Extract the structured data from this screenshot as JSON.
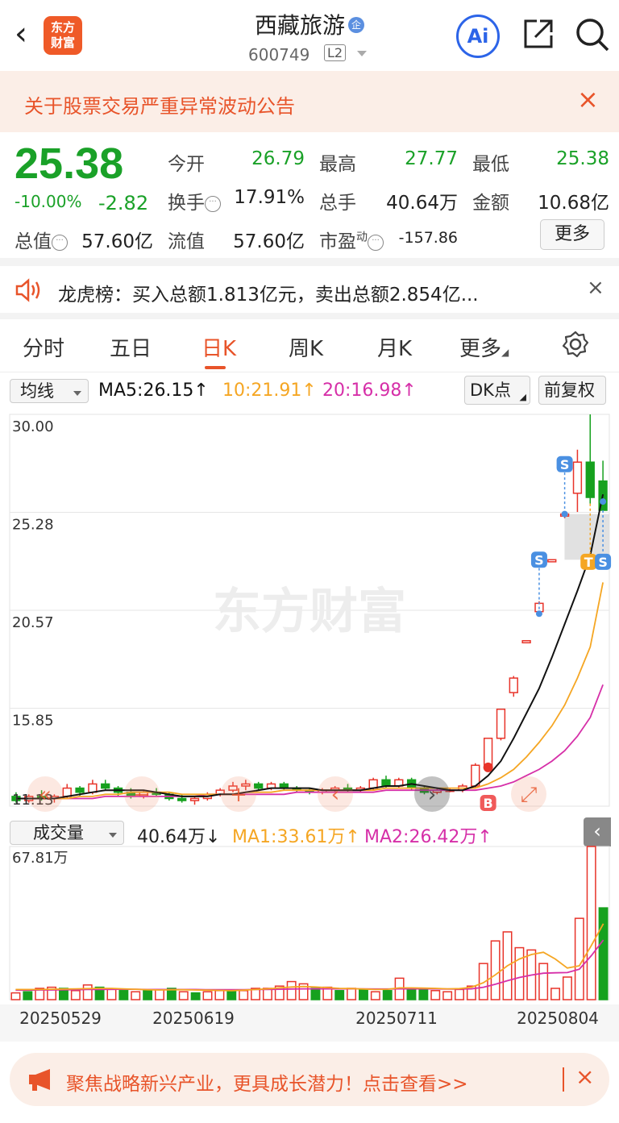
{
  "header": {
    "back_icon": "back-arrow-icon",
    "logo_text_1": "东方",
    "logo_text_2": "财富",
    "title": "西藏旅游",
    "enterprise_badge": "企",
    "code": "600749",
    "level": "L2",
    "ai_label": "Ai",
    "share_icon": "share-icon",
    "search_icon": "search-icon"
  },
  "notice": {
    "text": "关于股票交易严重异常波动公告",
    "close": "×"
  },
  "quote": {
    "price": "25.38",
    "change_pct": "-10.00%",
    "change_amt": "-2.82",
    "open_label": "今开",
    "open": "26.79",
    "high_label": "最高",
    "high": "27.77",
    "low_label": "最低",
    "low": "25.38",
    "turnover_label": "换手",
    "turnover": "17.91%",
    "volume_label": "总手",
    "volume": "40.64万",
    "amount_label": "金额",
    "amount": "10.68亿",
    "mktcap_label": "总值",
    "mktcap": "57.60亿",
    "float_label": "流值",
    "float_cap": "57.60亿",
    "pe_label": "市盈",
    "pe_sup": "动",
    "pe": "-157.86",
    "more_label": "更多"
  },
  "lhb": {
    "text": "龙虎榜：买入总额1.813亿元，卖出总额2.854亿...",
    "close": "×"
  },
  "tabs": [
    "分时",
    "五日",
    "日K",
    "周K",
    "月K",
    "更多"
  ],
  "active_tab": "日K",
  "ma_bar": {
    "selector": "均线",
    "ma5": "MA5:26.15↑",
    "ma10": "10:21.91↑",
    "ma20": "20:16.98↑",
    "dk_label": "DK点",
    "fuquan_label": "前复权"
  },
  "vol_bar": {
    "selector": "成交量",
    "vol": "40.64万↓",
    "ma1": "MA1:33.61万↑",
    "ma2": "MA2:26.42万↑"
  },
  "colors": {
    "up": "#e8342a",
    "down": "#16a11e",
    "ma5": "#111111",
    "ma10": "#f5a623",
    "ma20": "#d62fa8",
    "accent": "#e8542a"
  },
  "bottom_ad": {
    "text": "聚焦战略新兴产业，更具成长潜力！点击查看>>",
    "close": "×"
  },
  "chart_data": [
    {
      "type": "candlestick",
      "watermark": "东方财富",
      "y_ticks": [
        "30.00",
        "25.28",
        "20.57",
        "15.85",
        "11.13"
      ],
      "ylim": [
        11.13,
        30.0
      ],
      "x_ticks": [
        "20250529",
        "20250619",
        "20250711",
        "20250804"
      ],
      "candles": [
        {
          "o": 11.6,
          "h": 11.8,
          "l": 11.3,
          "c": 11.4
        },
        {
          "o": 11.4,
          "h": 11.7,
          "l": 11.3,
          "c": 11.6
        },
        {
          "o": 11.6,
          "h": 11.9,
          "l": 11.4,
          "c": 11.5
        },
        {
          "o": 11.5,
          "h": 11.7,
          "l": 11.3,
          "c": 11.6
        },
        {
          "o": 11.6,
          "h": 12.2,
          "l": 11.5,
          "c": 12.0
        },
        {
          "o": 12.0,
          "h": 12.1,
          "l": 11.6,
          "c": 11.8
        },
        {
          "o": 11.8,
          "h": 12.4,
          "l": 11.7,
          "c": 12.2
        },
        {
          "o": 12.2,
          "h": 12.4,
          "l": 11.9,
          "c": 12.0
        },
        {
          "o": 12.0,
          "h": 12.1,
          "l": 11.6,
          "c": 11.8
        },
        {
          "o": 11.8,
          "h": 12.0,
          "l": 11.5,
          "c": 11.6
        },
        {
          "o": 11.6,
          "h": 11.9,
          "l": 11.5,
          "c": 11.8
        },
        {
          "o": 11.8,
          "h": 12.0,
          "l": 11.6,
          "c": 11.7
        },
        {
          "o": 11.7,
          "h": 11.8,
          "l": 11.4,
          "c": 11.5
        },
        {
          "o": 11.5,
          "h": 11.7,
          "l": 11.3,
          "c": 11.4
        },
        {
          "o": 11.4,
          "h": 11.6,
          "l": 11.2,
          "c": 11.5
        },
        {
          "o": 11.5,
          "h": 11.8,
          "l": 11.4,
          "c": 11.7
        },
        {
          "o": 11.7,
          "h": 12.0,
          "l": 11.6,
          "c": 11.9
        },
        {
          "o": 11.9,
          "h": 12.3,
          "l": 11.8,
          "c": 12.1
        },
        {
          "o": 12.1,
          "h": 12.4,
          "l": 11.9,
          "c": 12.2
        },
        {
          "o": 12.2,
          "h": 12.3,
          "l": 11.9,
          "c": 12.0
        },
        {
          "o": 12.0,
          "h": 12.3,
          "l": 11.9,
          "c": 12.2
        },
        {
          "o": 12.2,
          "h": 12.3,
          "l": 11.9,
          "c": 12.0
        },
        {
          "o": 12.0,
          "h": 12.1,
          "l": 11.8,
          "c": 11.9
        },
        {
          "o": 11.9,
          "h": 12.0,
          "l": 11.7,
          "c": 11.8
        },
        {
          "o": 11.8,
          "h": 12.0,
          "l": 11.7,
          "c": 11.9
        },
        {
          "o": 11.9,
          "h": 12.1,
          "l": 11.8,
          "c": 12.0
        },
        {
          "o": 12.0,
          "h": 12.2,
          "l": 11.8,
          "c": 11.9
        },
        {
          "o": 11.9,
          "h": 12.1,
          "l": 11.8,
          "c": 12.0
        },
        {
          "o": 12.0,
          "h": 12.5,
          "l": 11.9,
          "c": 12.4
        },
        {
          "o": 12.4,
          "h": 12.6,
          "l": 12.0,
          "c": 12.1
        },
        {
          "o": 12.1,
          "h": 12.5,
          "l": 12.0,
          "c": 12.4
        },
        {
          "o": 12.4,
          "h": 12.5,
          "l": 11.9,
          "c": 12.0
        },
        {
          "o": 12.0,
          "h": 12.1,
          "l": 11.7,
          "c": 11.8
        },
        {
          "o": 11.8,
          "h": 12.0,
          "l": 11.7,
          "c": 11.9
        },
        {
          "o": 11.9,
          "h": 12.0,
          "l": 11.8,
          "c": 11.9
        },
        {
          "o": 11.9,
          "h": 12.2,
          "l": 11.8,
          "c": 12.1
        },
        {
          "o": 12.1,
          "h": 13.2,
          "l": 12.0,
          "c": 13.1
        },
        {
          "o": 13.1,
          "h": 14.4,
          "l": 13.0,
          "c": 14.4
        },
        {
          "o": 14.4,
          "h": 15.8,
          "l": 14.3,
          "c": 15.8
        },
        {
          "o": 16.6,
          "h": 17.4,
          "l": 16.4,
          "c": 17.3
        },
        {
          "o": 19.0,
          "h": 19.1,
          "l": 19.0,
          "c": 19.1
        },
        {
          "o": 20.5,
          "h": 21.0,
          "l": 20.3,
          "c": 20.9
        },
        {
          "o": 22.9,
          "h": 23.0,
          "l": 22.9,
          "c": 23.0
        },
        {
          "o": 25.1,
          "h": 25.3,
          "l": 25.0,
          "c": 25.2
        },
        {
          "o": 26.2,
          "h": 28.3,
          "l": 25.3,
          "c": 27.7
        },
        {
          "o": 27.7,
          "h": 30.0,
          "l": 25.7,
          "c": 26.0
        },
        {
          "o": 26.79,
          "h": 27.77,
          "l": 25.38,
          "c": 25.38
        }
      ],
      "ma5": [
        11.5,
        11.5,
        11.5,
        11.5,
        11.6,
        11.7,
        11.8,
        11.9,
        11.9,
        11.9,
        11.9,
        11.8,
        11.7,
        11.6,
        11.6,
        11.6,
        11.7,
        11.7,
        11.8,
        11.9,
        12.0,
        12.0,
        12.0,
        12.0,
        11.9,
        11.9,
        11.9,
        11.9,
        12.0,
        12.1,
        12.1,
        12.2,
        12.1,
        12.0,
        11.9,
        11.9,
        12.1,
        12.6,
        13.3,
        14.4,
        15.6,
        16.8,
        18.3,
        19.9,
        21.5,
        23.2,
        26.15
      ],
      "ma10": [
        11.5,
        11.5,
        11.5,
        11.5,
        11.5,
        11.6,
        11.6,
        11.7,
        11.7,
        11.8,
        11.8,
        11.8,
        11.8,
        11.7,
        11.7,
        11.7,
        11.7,
        11.7,
        11.8,
        11.8,
        11.8,
        11.9,
        11.9,
        11.9,
        11.9,
        11.9,
        11.9,
        11.9,
        11.9,
        12.0,
        12.0,
        12.0,
        12.0,
        12.0,
        12.0,
        12.0,
        12.0,
        12.2,
        12.5,
        12.9,
        13.5,
        14.2,
        15.0,
        16.0,
        17.3,
        18.8,
        21.91
      ],
      "ma20": [
        11.5,
        11.5,
        11.5,
        11.5,
        11.5,
        11.5,
        11.5,
        11.6,
        11.6,
        11.6,
        11.6,
        11.6,
        11.6,
        11.6,
        11.6,
        11.7,
        11.7,
        11.7,
        11.7,
        11.7,
        11.7,
        11.7,
        11.8,
        11.8,
        11.8,
        11.8,
        11.8,
        11.8,
        11.8,
        11.9,
        11.9,
        11.9,
        11.9,
        11.9,
        11.9,
        11.9,
        11.9,
        12.0,
        12.1,
        12.3,
        12.6,
        12.9,
        13.3,
        13.8,
        14.5,
        15.4,
        16.98
      ],
      "markers": [
        "B",
        "S",
        "S",
        "T",
        "S"
      ]
    },
    {
      "type": "bar",
      "y_ticks": [
        "67.81万"
      ],
      "ylim": [
        0,
        67.81
      ],
      "volumes": [
        3,
        3.5,
        5,
        5.5,
        5,
        4,
        6.5,
        5.5,
        4.5,
        4,
        3.5,
        4,
        4.5,
        5,
        3.5,
        3,
        3.5,
        4,
        3.5,
        4,
        5,
        5,
        6,
        8,
        7,
        5,
        5.5,
        4,
        5,
        4.5,
        3.5,
        4,
        9.5,
        4.5,
        5,
        4,
        3.5,
        4.5,
        6,
        16,
        26,
        30,
        23,
        22,
        16,
        5,
        10,
        36,
        67.81,
        40.64
      ],
      "vol_up": [
        true,
        false,
        true,
        true,
        false,
        true,
        true,
        false,
        true,
        false,
        true,
        false,
        true,
        false,
        true,
        false,
        true,
        true,
        false,
        true,
        true,
        true,
        true,
        true,
        true,
        false,
        true,
        false,
        true,
        false,
        true,
        false,
        true,
        false,
        false,
        true,
        true,
        true,
        true,
        true,
        true,
        true,
        true,
        true,
        true,
        true,
        true,
        true,
        true,
        false
      ],
      "ma1": [
        4.5,
        4.5,
        4.5,
        4.6,
        4.7,
        4.8,
        4.9,
        5.0,
        5.0,
        4.8,
        4.6,
        4.4,
        4.3,
        4.4,
        4.4,
        4.3,
        4.2,
        4.1,
        4.0,
        4.2,
        4.5,
        4.8,
        5.2,
        5.6,
        5.8,
        5.6,
        5.3,
        5.0,
        4.9,
        4.7,
        4.5,
        4.6,
        5.2,
        5.2,
        5.1,
        5.0,
        4.8,
        4.9,
        5.5,
        7.5,
        11,
        15,
        18,
        20,
        21,
        18,
        14,
        15,
        24,
        33.61
      ],
      "ma2": [
        4.2,
        4.2,
        4.3,
        4.3,
        4.4,
        4.4,
        4.5,
        4.5,
        4.6,
        4.6,
        4.6,
        4.5,
        4.5,
        4.5,
        4.5,
        4.5,
        4.4,
        4.4,
        4.4,
        4.4,
        4.5,
        4.5,
        4.6,
        4.7,
        4.8,
        4.8,
        4.8,
        4.8,
        4.8,
        4.8,
        4.7,
        4.7,
        4.8,
        4.8,
        4.8,
        4.8,
        4.7,
        4.7,
        4.8,
        5.5,
        6.8,
        8.4,
        9.8,
        10.9,
        11.7,
        11.9,
        12.0,
        13.5,
        19.5,
        26.42
      ]
    }
  ]
}
